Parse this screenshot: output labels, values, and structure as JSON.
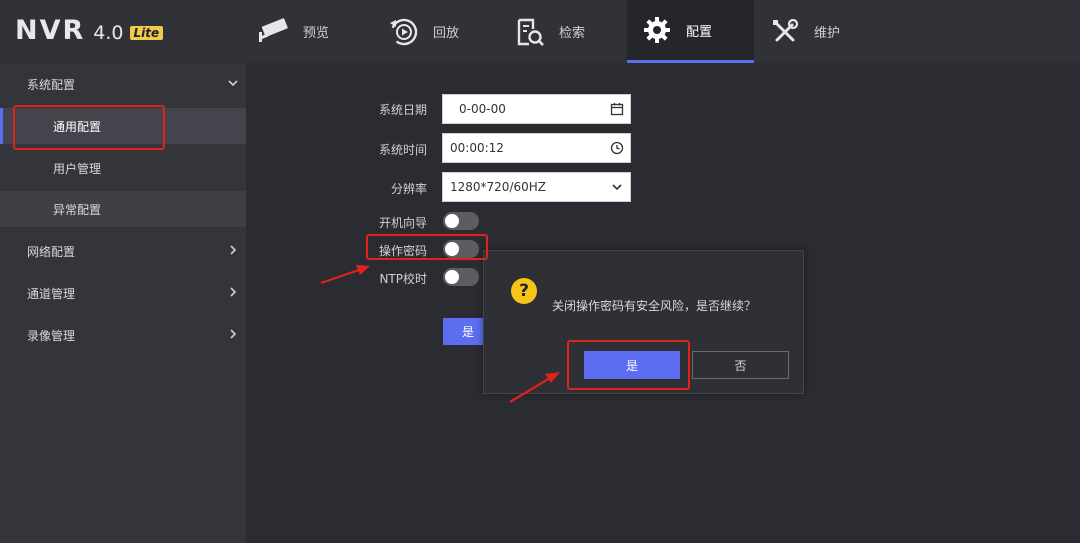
{
  "logo": {
    "brand": "NVR",
    "version": "4.0",
    "edition": "Lite"
  },
  "nav": {
    "tabs": [
      {
        "label": "预览",
        "icon": "camera-icon"
      },
      {
        "label": "回放",
        "icon": "playback-icon"
      },
      {
        "label": "检索",
        "icon": "search-file-icon"
      },
      {
        "label": "配置",
        "icon": "gear-icon",
        "active": true
      },
      {
        "label": "维护",
        "icon": "tools-icon"
      }
    ]
  },
  "sidebar": {
    "groups": [
      {
        "label": "系统配置",
        "expanded": true,
        "items": [
          {
            "label": "通用配置",
            "active": true
          },
          {
            "label": "用户管理"
          },
          {
            "label": "异常配置"
          }
        ]
      },
      {
        "label": "网络配置"
      },
      {
        "label": "通道管理"
      },
      {
        "label": "录像管理"
      }
    ]
  },
  "form": {
    "date": {
      "label": "系统日期",
      "value": "0-00-00"
    },
    "time": {
      "label": "系统时间",
      "value": "00:00:12"
    },
    "resolution": {
      "label": "分辨率",
      "value": "1280*720/60HZ"
    },
    "boot_wizard": {
      "label": "开机向导",
      "on": false
    },
    "op_password": {
      "label": "操作密码",
      "on": false
    },
    "ntp": {
      "label": "NTP校时",
      "on": false
    },
    "save_label": "是"
  },
  "dialog": {
    "icon": "?",
    "message": "关闭操作密码有安全风险，是否继续？",
    "confirm_label": "是",
    "cancel_label": "否"
  },
  "colors": {
    "accent": "#5c6df0",
    "annotation": "#e0221c",
    "warning": "#f5c518"
  }
}
